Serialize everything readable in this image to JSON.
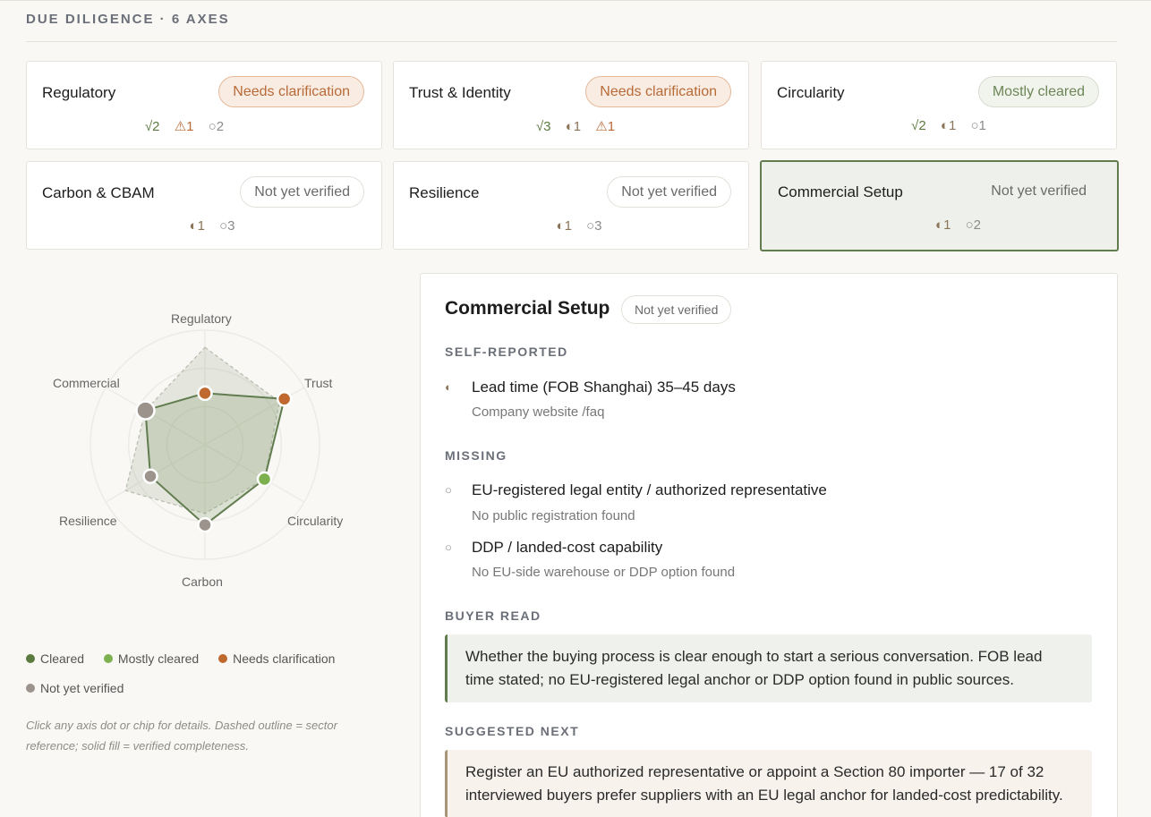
{
  "section": {
    "title": "DUE DILIGENCE · 6 AXES"
  },
  "colors": {
    "cleared": "#5c7a3f",
    "mostly_cleared": "#7db04f",
    "needs_clarification": "#c0692f",
    "not_yet_verified": "#9c948c",
    "accent": "#617c4e"
  },
  "axes": [
    {
      "name": "Regulatory",
      "status": "Needs clarification",
      "counts": [
        {
          "icon": "check-icon",
          "glyph": "√",
          "value": "2"
        },
        {
          "icon": "warning-icon",
          "glyph": "⚠",
          "value": "1"
        },
        {
          "icon": "empty-circle-icon",
          "glyph": "○",
          "value": "2"
        }
      ]
    },
    {
      "name": "Trust & Identity",
      "status": "Needs clarification",
      "counts": [
        {
          "icon": "check-icon",
          "glyph": "√",
          "value": "3"
        },
        {
          "icon": "half-circle-icon",
          "glyph": "◐",
          "value": "1"
        },
        {
          "icon": "warning-icon",
          "glyph": "⚠",
          "value": "1"
        }
      ]
    },
    {
      "name": "Circularity",
      "status": "Mostly cleared",
      "counts": [
        {
          "icon": "check-icon",
          "glyph": "√",
          "value": "2"
        },
        {
          "icon": "half-circle-icon",
          "glyph": "◐",
          "value": "1"
        },
        {
          "icon": "empty-circle-icon",
          "glyph": "○",
          "value": "1"
        }
      ]
    },
    {
      "name": "Carbon & CBAM",
      "status": "Not yet verified",
      "counts": [
        {
          "icon": "half-circle-icon",
          "glyph": "◐",
          "value": "1"
        },
        {
          "icon": "empty-circle-icon",
          "glyph": "○",
          "value": "3"
        }
      ]
    },
    {
      "name": "Resilience",
      "status": "Not yet verified",
      "counts": [
        {
          "icon": "half-circle-icon",
          "glyph": "◐",
          "value": "1"
        },
        {
          "icon": "empty-circle-icon",
          "glyph": "○",
          "value": "3"
        }
      ]
    },
    {
      "name": "Commercial Setup",
      "status": "Not yet verified",
      "selected": true,
      "counts": [
        {
          "icon": "half-circle-icon",
          "glyph": "◐",
          "value": "1"
        },
        {
          "icon": "empty-circle-icon",
          "glyph": "○",
          "value": "2"
        }
      ]
    }
  ],
  "radar": {
    "labels": [
      "Regulatory",
      "Trust",
      "Circularity",
      "Carbon",
      "Resilience",
      "Commercial"
    ],
    "verified_completeness": [
      0.45,
      0.8,
      0.6,
      0.7,
      0.55,
      0.6
    ],
    "sector_reference": [
      0.85,
      0.75,
      0.6,
      0.6,
      0.8,
      0.6
    ],
    "point_status": [
      "needs",
      "needs",
      "mostly",
      "notyet",
      "notyet",
      "notyet"
    ],
    "selected_index": 5
  },
  "legend": [
    {
      "label": "Cleared",
      "status": "cleared"
    },
    {
      "label": "Mostly cleared",
      "status": "mostly"
    },
    {
      "label": "Needs clarification",
      "status": "needs"
    },
    {
      "label": "Not yet verified",
      "status": "notyet"
    }
  ],
  "hint": "Click any axis dot or chip for details. Dashed outline = sector reference; solid fill = verified completeness.",
  "detail": {
    "title": "Commercial Setup",
    "status": "Not yet verified",
    "self_reported_heading": "SELF-REPORTED",
    "self_reported": [
      {
        "icon": "half-circle-icon",
        "glyph": "◐",
        "title": "Lead time (FOB Shanghai) 35–45 days",
        "source": "Company website /faq"
      }
    ],
    "missing_heading": "MISSING",
    "missing": [
      {
        "icon": "empty-circle-icon",
        "glyph": "○",
        "title": "EU-registered legal entity / authorized representative",
        "source": "No public registration found"
      },
      {
        "icon": "empty-circle-icon",
        "glyph": "○",
        "title": "DDP / landed-cost capability",
        "source": "No EU-side warehouse or DDP option found"
      }
    ],
    "buyer_read_heading": "BUYER READ",
    "buyer_read": "Whether the buying process is clear enough to start a serious conversation. FOB lead time stated; no EU-registered legal anchor or DDP option found in public sources.",
    "suggested_next_heading": "SUGGESTED NEXT",
    "suggested_next": "Register an EU authorized representative or appoint a Section 80 importer — 17 of 32 interviewed buyers prefer suppliers with an EU legal anchor for landed-cost predictability."
  }
}
